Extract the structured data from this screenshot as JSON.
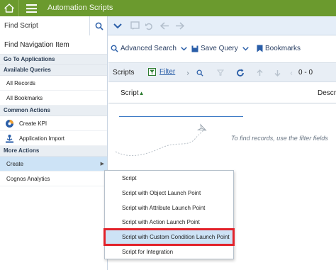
{
  "app": {
    "title": "Automation Scripts"
  },
  "find": {
    "label": "Find Script"
  },
  "toolbar": {
    "icons": [
      "chevron-down-icon",
      "save-record-icon",
      "undo-icon",
      "back-icon",
      "forward-icon"
    ]
  },
  "nav": {
    "find_label": "Find Navigation Item",
    "go_to_apps": "Go To Applications",
    "available_queries": "Available Queries",
    "queries": [
      "All Records",
      "All Bookmarks"
    ],
    "common_actions": "Common Actions",
    "common": [
      {
        "label": "Create KPI",
        "icon": "kpi-icon"
      },
      {
        "label": "Application Import",
        "icon": "import-icon"
      }
    ],
    "more_actions": "More Actions",
    "more": [
      {
        "label": "Create",
        "has_submenu": true
      },
      {
        "label": "Cognos Analytics"
      }
    ]
  },
  "actions": {
    "advanced_search": "Advanced Search",
    "save_query": "Save Query",
    "bookmarks": "Bookmarks"
  },
  "list": {
    "tab": "Scripts",
    "filter": "Filter",
    "pager": "0 - 0",
    "columns": [
      "Script",
      "Descr"
    ],
    "empty_message": "To find records, use the filter fields"
  },
  "flyout": {
    "items": [
      "Script",
      "Script with Object Launch Point",
      "Script with Attribute Launch Point",
      "Script with Action Launch Point",
      "Script with Custom Condition Launch Point",
      "Script for Integration"
    ],
    "highlighted_index": 4
  },
  "colors": {
    "topbar": "#6b9a2e",
    "accent": "#2a5ea8",
    "highlight_border": "#e2232b"
  }
}
